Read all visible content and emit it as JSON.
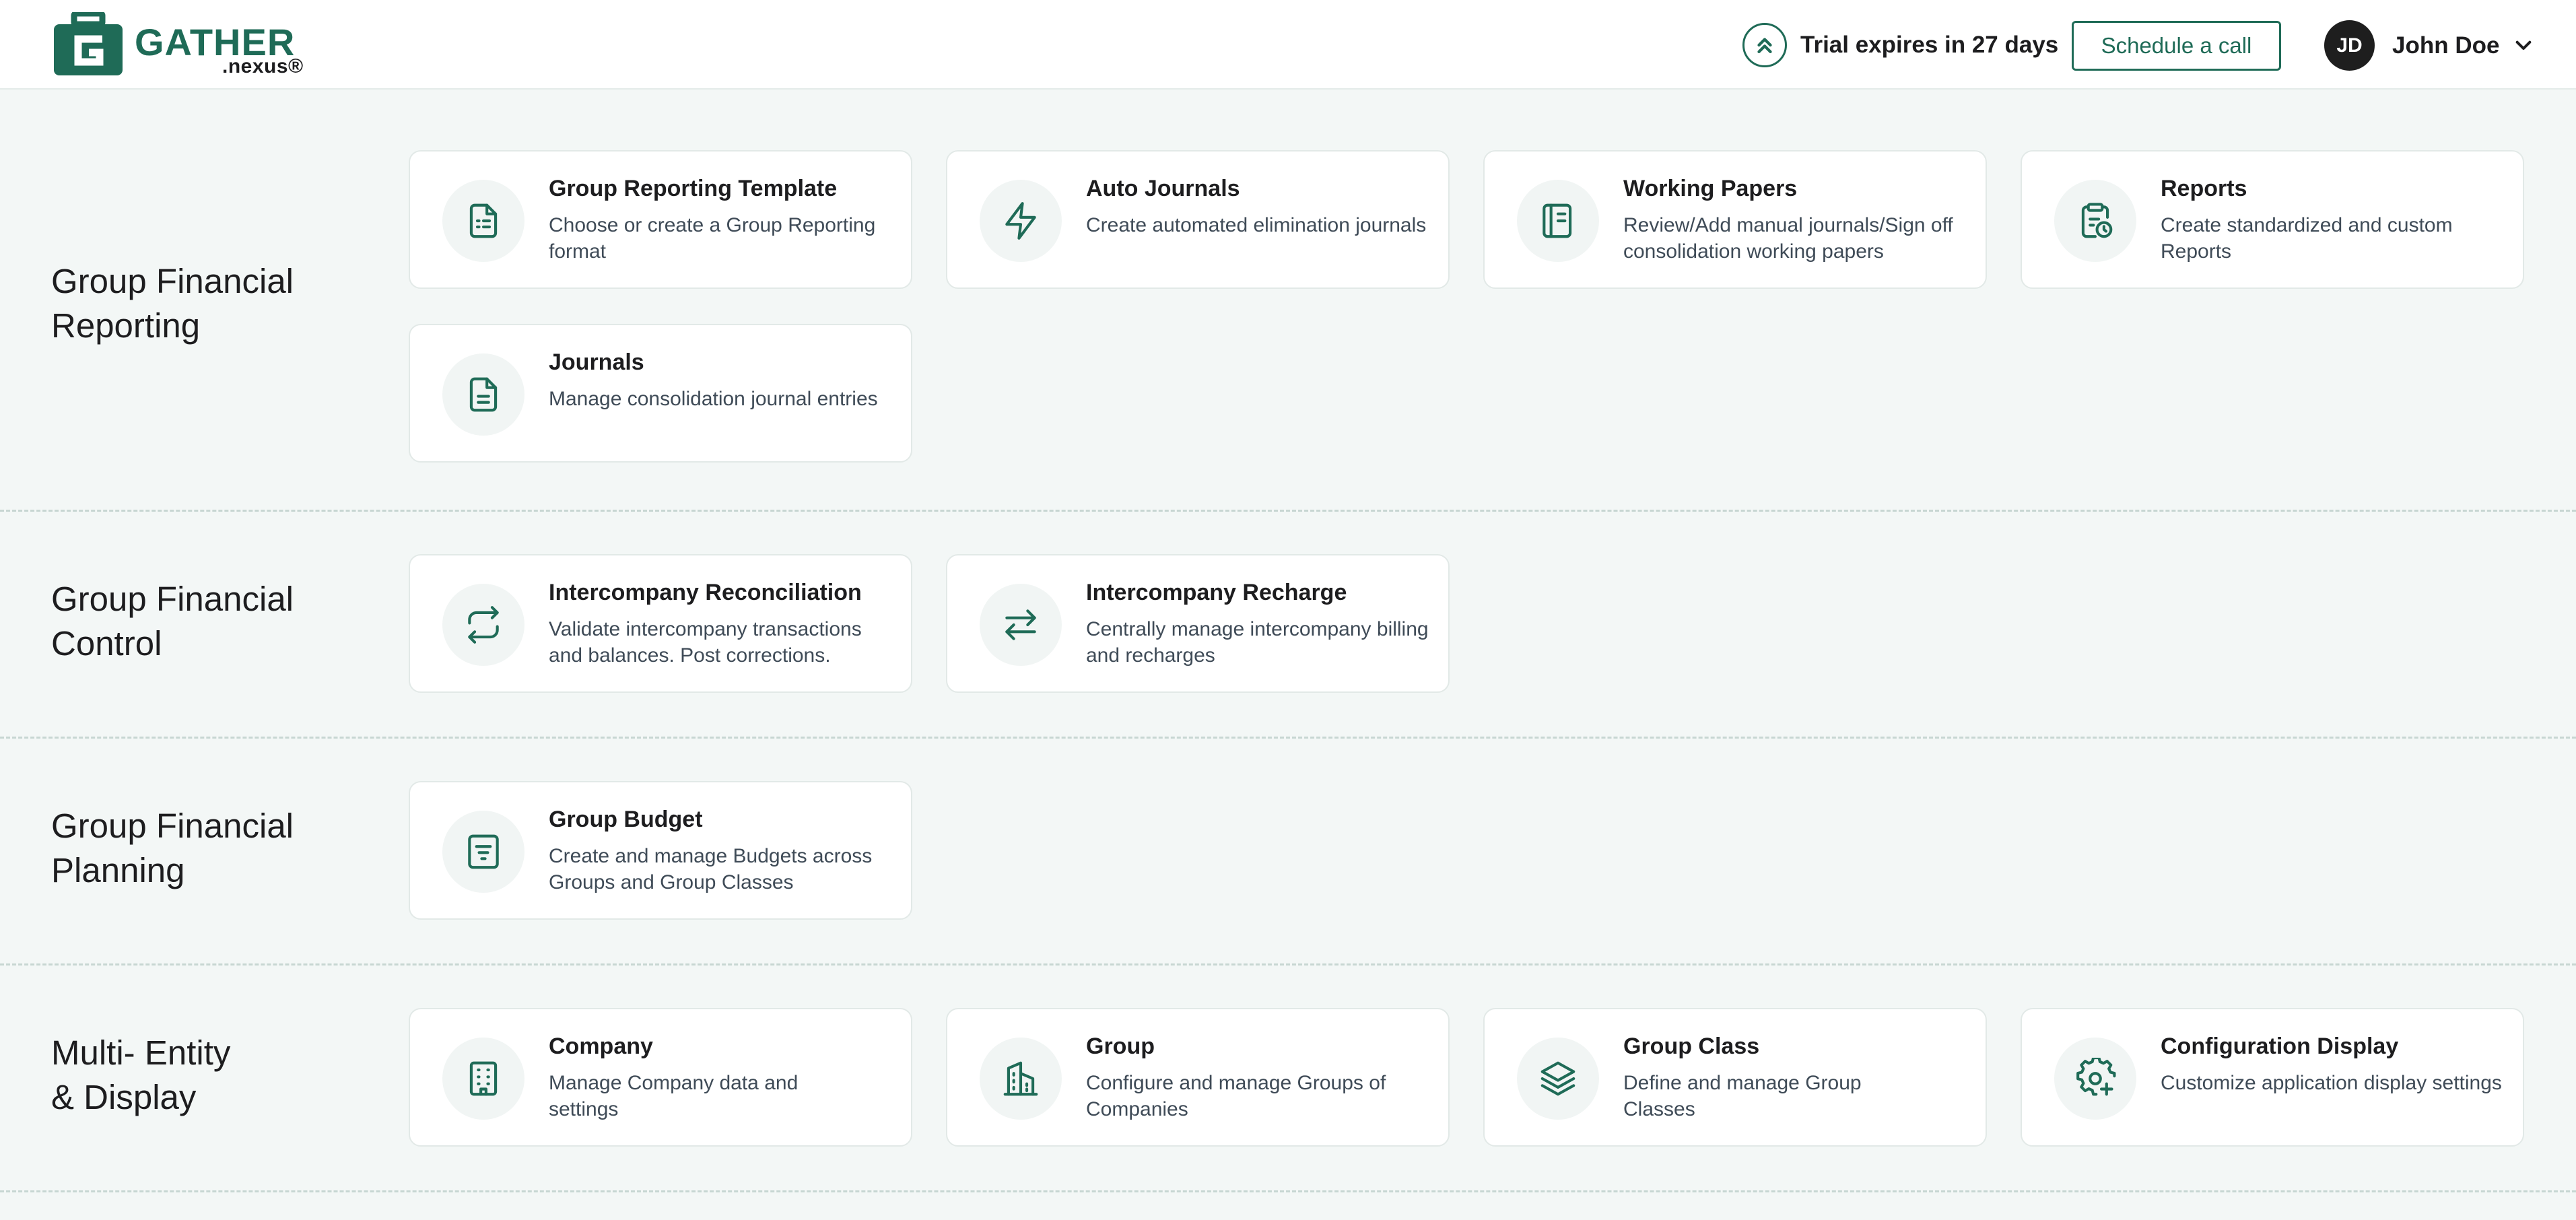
{
  "brand": {
    "name": "GATHER",
    "suffix": ".nexus®",
    "accent": "#1f6b57"
  },
  "header": {
    "trial_text": "Trial expires in 27 days",
    "schedule_label": "Schedule a call",
    "user": {
      "initials": "JD",
      "name": "John Doe"
    }
  },
  "sections": [
    {
      "title": "Group Financial\nReporting",
      "cards": [
        {
          "title": "Group Reporting Template",
          "desc": "Choose or create a Group Reporting format",
          "icon": "file-list-icon"
        },
        {
          "title": "Auto Journals",
          "desc": "Create automated elimination journals",
          "icon": "lightning-icon"
        },
        {
          "title": "Working Papers",
          "desc": "Review/Add manual journals/Sign off consolidation working papers",
          "icon": "notebook-icon"
        },
        {
          "title": "Reports",
          "desc": "Create standardized and custom Reports",
          "icon": "clipboard-clock-icon"
        },
        {
          "title": "Journals",
          "desc": "Manage consolidation journal entries",
          "icon": "file-text-icon"
        }
      ]
    },
    {
      "title": "Group Financial\nControl",
      "cards": [
        {
          "title": "Intercompany Reconciliation",
          "desc": "Validate intercompany transactions and balances. Post corrections.",
          "icon": "repeat-icon"
        },
        {
          "title": "Intercompany Recharge",
          "desc": "Centrally manage intercompany billing and recharges",
          "icon": "swap-arrows-icon"
        }
      ]
    },
    {
      "title": "Group Financial\nPlanning",
      "cards": [
        {
          "title": "Group Budget",
          "desc": "Create and manage Budgets across Groups and Group Classes",
          "icon": "budget-list-icon"
        }
      ]
    },
    {
      "title": "Multi- Entity\n& Display",
      "cards": [
        {
          "title": "Company",
          "desc": "Manage Company data and settings",
          "icon": "building-icon"
        },
        {
          "title": "Group",
          "desc": "Configure and manage Groups of Companies",
          "icon": "buildings-icon"
        },
        {
          "title": "Group Class",
          "desc": "Define and manage Group Classes",
          "icon": "layers-icon"
        },
        {
          "title": "Configuration Display",
          "desc": "Customize application display settings",
          "icon": "gear-plus-icon"
        }
      ]
    }
  ]
}
